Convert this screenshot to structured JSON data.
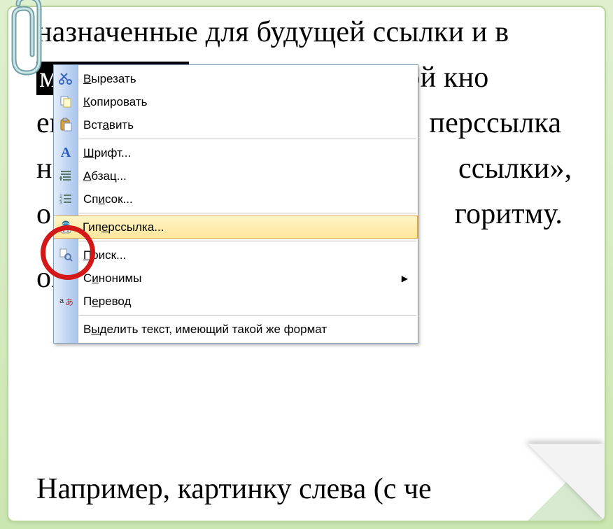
{
  "doc": {
    "line1a": "назначенные для будущей ссылки и в",
    "line2_sel": "мента Word",
    "line2b": "» нажимаем правой кно",
    "line3a": "ен",
    "line3b": "перссылка",
    "line4a": "на",
    "line4b": "ссылки», ",
    "line5a": "о ",
    "line5b": "горитму.",
    "line6a": "ой",
    "bottom": "Например, картинку слева (с че"
  },
  "menu": {
    "cut": {
      "pre": "",
      "u": "В",
      "post": "ырезать"
    },
    "copy": {
      "pre": "",
      "u": "К",
      "post": "опировать"
    },
    "paste": {
      "pre": "Вст",
      "u": "а",
      "post": "вить"
    },
    "font": {
      "pre": "",
      "u": "Ш",
      "post": "рифт..."
    },
    "para": {
      "pre": "",
      "u": "А",
      "post": "бзац..."
    },
    "list": {
      "pre": "Сп",
      "u": "и",
      "post": "сок..."
    },
    "hyper": {
      "pre": "Гип",
      "u": "е",
      "post": "рссылка..."
    },
    "find": {
      "pre": "",
      "u": "П",
      "post": "оиск..."
    },
    "syn": {
      "pre": "С",
      "u": "и",
      "post": "нонимы"
    },
    "trans": {
      "pre": "П",
      "u": "е",
      "post": "ревод"
    },
    "selsame": {
      "pre": "В",
      "u": "ы",
      "post": "делить текст, имеющий такой же формат"
    }
  }
}
